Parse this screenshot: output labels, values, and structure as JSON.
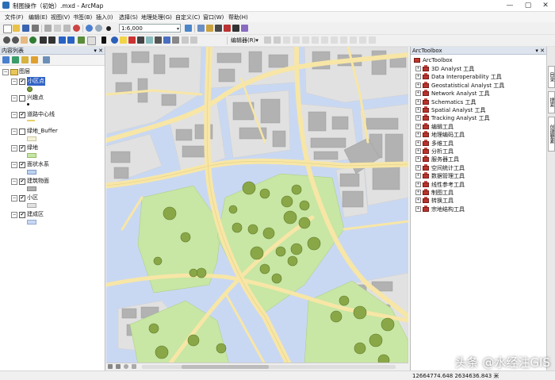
{
  "window": {
    "title": "制图操作（初始）.mxd - ArcMap",
    "controls": [
      "—",
      "▢",
      "✕"
    ]
  },
  "menu": {
    "items": [
      "文件(F)",
      "编辑(E)",
      "视图(V)",
      "书签(B)",
      "插入(I)",
      "选择(S)",
      "地理处理(G)",
      "自定义(C)",
      "窗口(W)",
      "帮助(H)"
    ]
  },
  "toolbar": {
    "scale_value": "1:6,000",
    "editor_label": "编辑器(R)▾"
  },
  "toc": {
    "title": "内容列表",
    "pins": "▾ ✕",
    "root_label": "图层",
    "layers": [
      {
        "name": "小区点",
        "checked": true,
        "selected": true,
        "symbol": "green-circle"
      },
      {
        "name": "兴趣点",
        "checked": false,
        "selected": false,
        "symbol": "black-dot"
      },
      {
        "name": "道路中心线",
        "checked": true,
        "selected": false,
        "symbol": "yellow-line"
      },
      {
        "name": "绿地_Buffer",
        "checked": false,
        "selected": false,
        "symbol": "pale-box"
      },
      {
        "name": "绿地",
        "checked": true,
        "selected": false,
        "symbol": "green-box"
      },
      {
        "name": "面状水系",
        "checked": true,
        "selected": false,
        "symbol": "blue-box"
      },
      {
        "name": "建筑物面",
        "checked": true,
        "selected": false,
        "symbol": "gray-box"
      },
      {
        "name": "小区",
        "checked": true,
        "selected": false,
        "symbol": "lightgray-box"
      },
      {
        "name": "建成区",
        "checked": true,
        "selected": false,
        "symbol": "lightblue-box"
      }
    ]
  },
  "toolbox": {
    "title": "ArcToolbox",
    "pins": "▾ ✕",
    "root_label": "ArcToolbox",
    "items": [
      "3D Analyst 工具",
      "Data Interoperability 工具",
      "Geostatistical Analyst 工具",
      "Network Analyst 工具",
      "Schematics 工具",
      "Spatial Analyst 工具",
      "Tracking Analyst 工具",
      "编辑工具",
      "地理编码工具",
      "多维工具",
      "分析工具",
      "服务器工具",
      "空间统计工具",
      "数据管理工具",
      "线性参考工具",
      "制图工具",
      "转换工具",
      "宗地结构工具"
    ]
  },
  "sidetabs": [
    "目录",
    "搜索",
    "创建要素"
  ],
  "status": {
    "coords": "12664774.648  2634636.843 米"
  },
  "watermark": "头条 @水经注GIS",
  "colors": {
    "map_bg": "#c9d8f2",
    "road": "#f7e6a6",
    "building": "#b2b2b2",
    "block": "#e1e1e1",
    "greenspace": "#c8e6a4",
    "tree": "#7a9a3c"
  }
}
